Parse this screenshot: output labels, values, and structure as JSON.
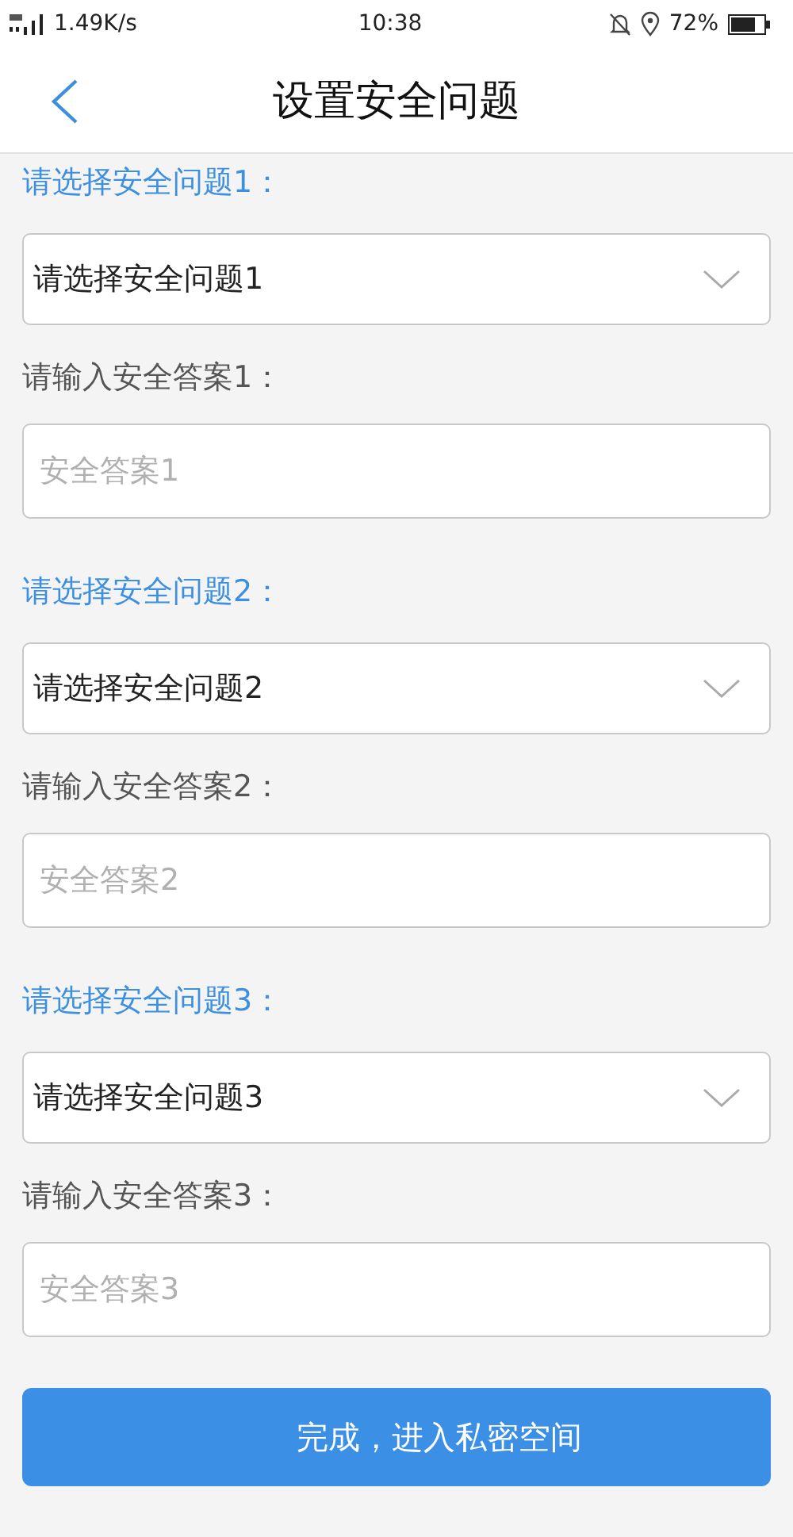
{
  "status_bar": {
    "network": "1.49K/s",
    "time": "10:38",
    "battery": "72%"
  },
  "header": {
    "title": "设置安全问题"
  },
  "sections": [
    {
      "question_label": "请选择安全问题1：",
      "question_value": "请选择安全问题1",
      "answer_label": "请输入安全答案1：",
      "answer_placeholder": "安全答案1"
    },
    {
      "question_label": "请选择安全问题2：",
      "question_value": "请选择安全问题2",
      "answer_label": "请输入安全答案2：",
      "answer_placeholder": "安全答案2"
    },
    {
      "question_label": "请选择安全问题3：",
      "question_value": "请选择安全问题3",
      "answer_label": "请输入安全答案3：",
      "answer_placeholder": "安全答案3"
    }
  ],
  "submit_button": "完成，进入私密空间"
}
